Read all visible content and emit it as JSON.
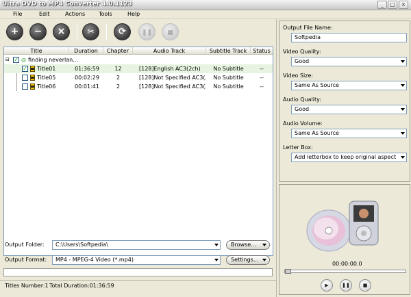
{
  "window": {
    "title": "Ultra DVD to MP4 Converter 4.0.1123"
  },
  "menu": [
    "File",
    "Edit",
    "Actions",
    "Tools",
    "Help"
  ],
  "toolbar": {
    "add_icon": "plus-icon",
    "remove_icon": "minus-icon",
    "clear_icon": "cross-icon",
    "trim_icon": "scissors-icon",
    "convert_icon": "refresh-icon",
    "pause_icon": "pause-icon",
    "stop_icon": "stop-icon"
  },
  "table": {
    "columns": [
      "Title",
      "Duration",
      "Chapter",
      "Audio Track",
      "Subtitle Track",
      "Status"
    ],
    "root": {
      "label": "finding neverlan...",
      "checked": true
    },
    "rows": [
      {
        "title": "Title01",
        "duration": "01:36:59",
        "chapter": "12",
        "audio": "[128]English AC3(2ch)",
        "subtitle": "No Subtitle",
        "status": "--",
        "checked": true,
        "selected": true
      },
      {
        "title": "Title05",
        "duration": "00:02:29",
        "chapter": "2",
        "audio": "[128]Not Specified AC3(...",
        "subtitle": "No Subtitle",
        "status": "--",
        "checked": false,
        "selected": false
      },
      {
        "title": "Title06",
        "duration": "00:01:41",
        "chapter": "2",
        "audio": "[128]Not Specified AC3(...",
        "subtitle": "No Subtitle",
        "status": "--",
        "checked": false,
        "selected": false
      }
    ]
  },
  "output": {
    "folder_label": "Output Folder:",
    "folder_value": "C:\\Users\\Softpedia\\",
    "browse_label": "Browse...",
    "format_label": "Output Format:",
    "format_value": "MP4 - MPEG-4 Video (*.mp4)",
    "settings_label": "Settings..."
  },
  "status": {
    "titles_number": "Titles Number:1",
    "total_duration": "Total Duration:01:36:59"
  },
  "settings": {
    "file_name_label": "Output File Name:",
    "file_name_value": "Softpedia",
    "video_quality_label": "Video Quality:",
    "video_quality_value": "Good",
    "video_size_label": "Video Size:",
    "video_size_value": "Same As Source",
    "audio_quality_label": "Audio Quality:",
    "audio_quality_value": "Good",
    "audio_volume_label": "Audio Volume:",
    "audio_volume_value": "Same As Source",
    "letterbox_label": "Letter Box:",
    "letterbox_value": "Add letterbox to keep original aspect"
  },
  "preview": {
    "time": "00:00:00.0"
  }
}
